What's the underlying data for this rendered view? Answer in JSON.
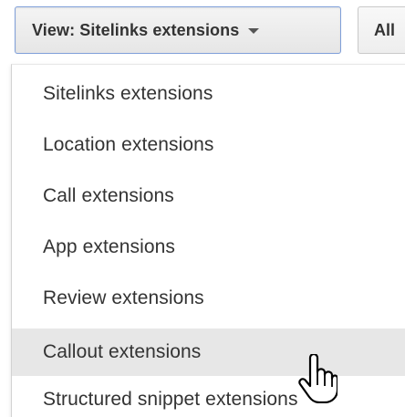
{
  "toolbar": {
    "view_button_label": "View: Sitelinks extensions",
    "all_button_label": "All"
  },
  "menu": {
    "items": [
      {
        "label": "Sitelinks extensions",
        "highlighted": false
      },
      {
        "label": "Location extensions",
        "highlighted": false
      },
      {
        "label": "Call extensions",
        "highlighted": false
      },
      {
        "label": "App extensions",
        "highlighted": false
      },
      {
        "label": "Review extensions",
        "highlighted": false
      },
      {
        "label": "Callout extensions",
        "highlighted": true
      },
      {
        "label": "Structured snippet extensions",
        "highlighted": false
      }
    ]
  },
  "icons": {
    "dropdown_caret": "caret-down-icon",
    "pointer": "hand-pointer-cursor-icon"
  },
  "colors": {
    "button_border": "#7f9fd9",
    "highlight": "#e7e7e7",
    "text": "#333333"
  }
}
